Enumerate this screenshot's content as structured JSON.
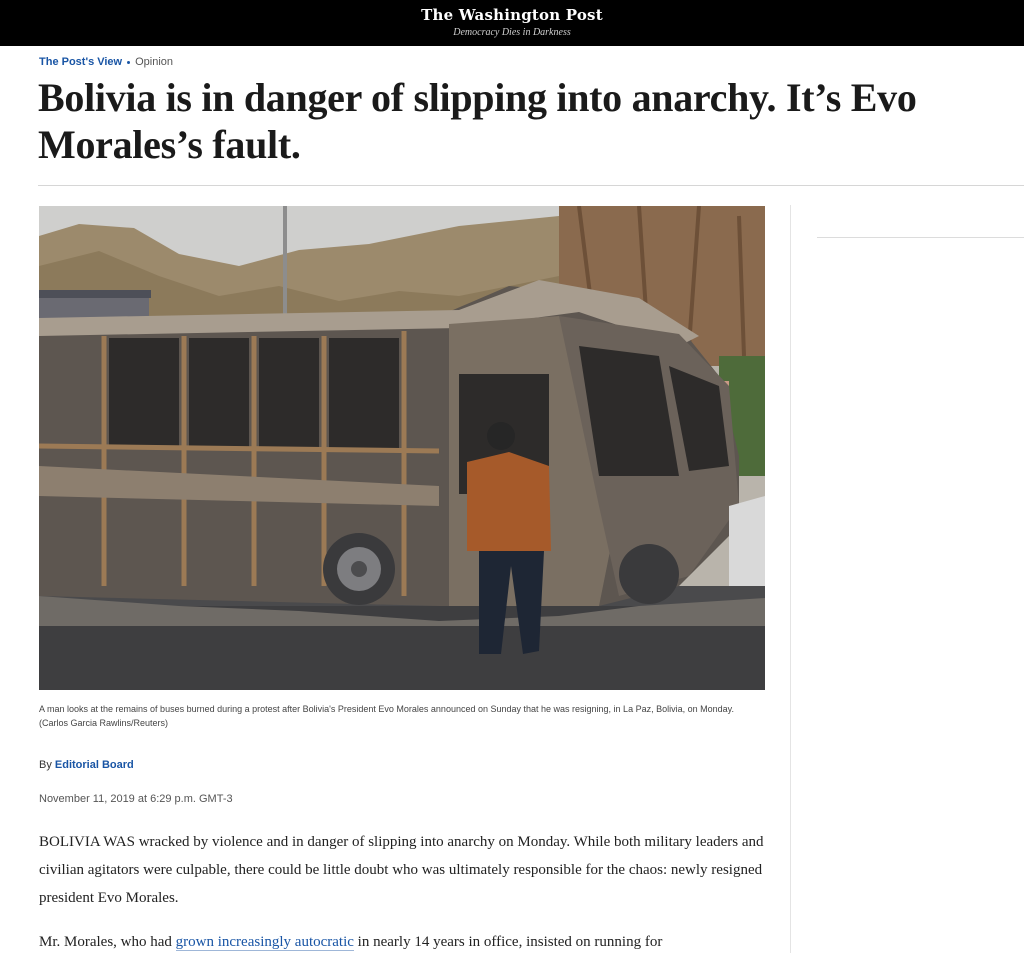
{
  "masthead": {
    "logo": "The Washington Post",
    "tagline": "Democracy Dies in Darkness"
  },
  "kicker": {
    "section": "The Post's View",
    "label": "Opinion"
  },
  "headline": "Bolivia is in danger of slipping into anarchy. It’s Evo Morales’s fault.",
  "photo": {
    "caption": "A man looks at the remains of buses burned during a protest after Bolivia's President Evo Morales announced on Sunday that he was resigning, in La Paz, Bolivia, on Monday. (Carlos Garcia Rawlins/Reuters)"
  },
  "byline": {
    "prefix": "By",
    "author": "Editorial Board"
  },
  "dateline": "November 11, 2019 at 6:29 p.m. GMT-3",
  "body": {
    "p1": "BOLIVIA WAS wracked by violence and in danger of slipping into anarchy on Monday. While both military leaders and civilian agitators were culpable, there could be little doubt who was ultimately responsible for the chaos: newly resigned president Evo Morales.",
    "p2_start": "Mr. Morales, who had",
    "p2_link": "grown increasingly autocratic",
    "p2_end": "in nearly 14 years in office, insisted on running for"
  }
}
